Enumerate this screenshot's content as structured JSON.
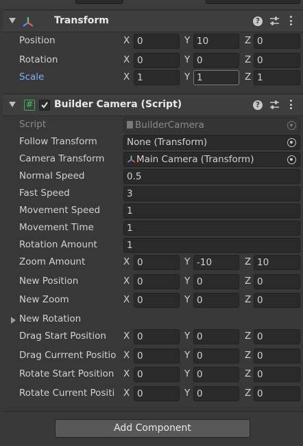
{
  "transform": {
    "title": "Transform",
    "rows": [
      {
        "label": "Position",
        "x": "0",
        "y": "10",
        "z": "0"
      },
      {
        "label": "Rotation",
        "x": "0",
        "y": "0",
        "z": "0"
      },
      {
        "label": "Scale",
        "x": "1",
        "y": "1",
        "z": "1"
      }
    ]
  },
  "builder": {
    "title": "Builder Camera (Script)",
    "enabled": true,
    "script_label": "Script",
    "script_value": "BuilderCamera",
    "follow_label": "Follow Transform",
    "follow_value": "None (Transform)",
    "camera_label": "Camera Transform",
    "camera_value": "Main Camera (Transform)",
    "normal_speed_label": "Normal Speed",
    "normal_speed_value": "0.5",
    "fast_speed_label": "Fast Speed",
    "fast_speed_value": "3",
    "movement_speed_label": "Movement Speed",
    "movement_speed_value": "1",
    "movement_time_label": "Movement Time",
    "movement_time_value": "1",
    "rotation_amount_label": "Rotation Amount",
    "rotation_amount_value": "1",
    "vec_rows_a": [
      {
        "label": "Zoom Amount",
        "x": "0",
        "y": "-10",
        "z": "10"
      },
      {
        "label": "New Position",
        "x": "0",
        "y": "0",
        "z": "0"
      },
      {
        "label": "New Zoom",
        "x": "0",
        "y": "0",
        "z": "0"
      }
    ],
    "new_rotation_label": "New Rotation",
    "vec_rows_b": [
      {
        "label": "Drag Start Position",
        "x": "0",
        "y": "0",
        "z": "0"
      },
      {
        "label": "Drag Currrent Positio",
        "x": "0",
        "y": "0",
        "z": "0"
      },
      {
        "label": "Rotate Start Position",
        "x": "0",
        "y": "0",
        "z": "0"
      },
      {
        "label": "Rotate Current Positi",
        "x": "0",
        "y": "0",
        "z": "0"
      }
    ]
  },
  "axes": {
    "x": "X",
    "y": "Y",
    "z": "Z"
  },
  "add_component_label": "Add Component",
  "help_glyph": "?",
  "colors": {
    "accent_blue": "#7fb2ff",
    "script_green": "#3fae55",
    "panel": "#383838"
  }
}
